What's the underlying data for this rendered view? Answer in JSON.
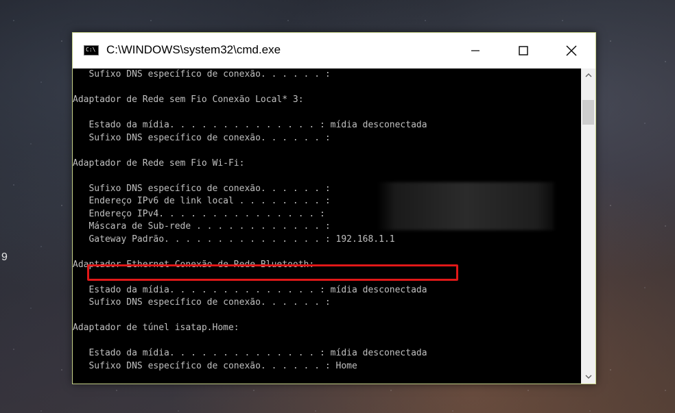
{
  "window": {
    "title": "C:\\WINDOWS\\system32\\cmd.exe",
    "icon_label": "C:\\"
  },
  "desktop": {
    "edge_char": "9"
  },
  "console": {
    "lines": [
      "   Sufixo DNS específico de conexão. . . . . . :",
      "",
      "Adaptador de Rede sem Fio Conexão Local* 3:",
      "",
      "   Estado da mídia. . . . . . . . . . . . . . : mídia desconectada",
      "   Sufixo DNS específico de conexão. . . . . . :",
      "",
      "Adaptador de Rede sem Fio Wi-Fi:",
      "",
      "   Sufixo DNS específico de conexão. . . . . . :",
      "   Endereço IPv6 de link local . . . . . . . . :",
      "   Endereço IPv4. . . . . . . . . . . . . . . :",
      "   Máscara de Sub-rede . . . . . . . . . . . . :",
      "   Gateway Padrão. . . . . . . . . . . . . . . : 192.168.1.1",
      "",
      "Adaptador Ethernet Conexão de Rede Bluetooth:",
      "",
      "   Estado da mídia. . . . . . . . . . . . . . : mídia desconectada",
      "   Sufixo DNS específico de conexão. . . . . . :",
      "",
      "Adaptador de túnel isatap.Home:",
      "",
      "   Estado da mídia. . . . . . . . . . . . . . : mídia desconectada",
      "   Sufixo DNS específico de conexão. . . . . . : Home"
    ]
  },
  "colors": {
    "console_bg": "#000000",
    "console_text": "#c0c0c0",
    "highlight": "#e11818",
    "window_border": "#c9d48a"
  },
  "icons": {
    "minimize": "minimize-icon",
    "maximize": "maximize-icon",
    "close": "close-icon",
    "scroll_up": "chevron-up-icon",
    "scroll_down": "chevron-down-icon"
  }
}
